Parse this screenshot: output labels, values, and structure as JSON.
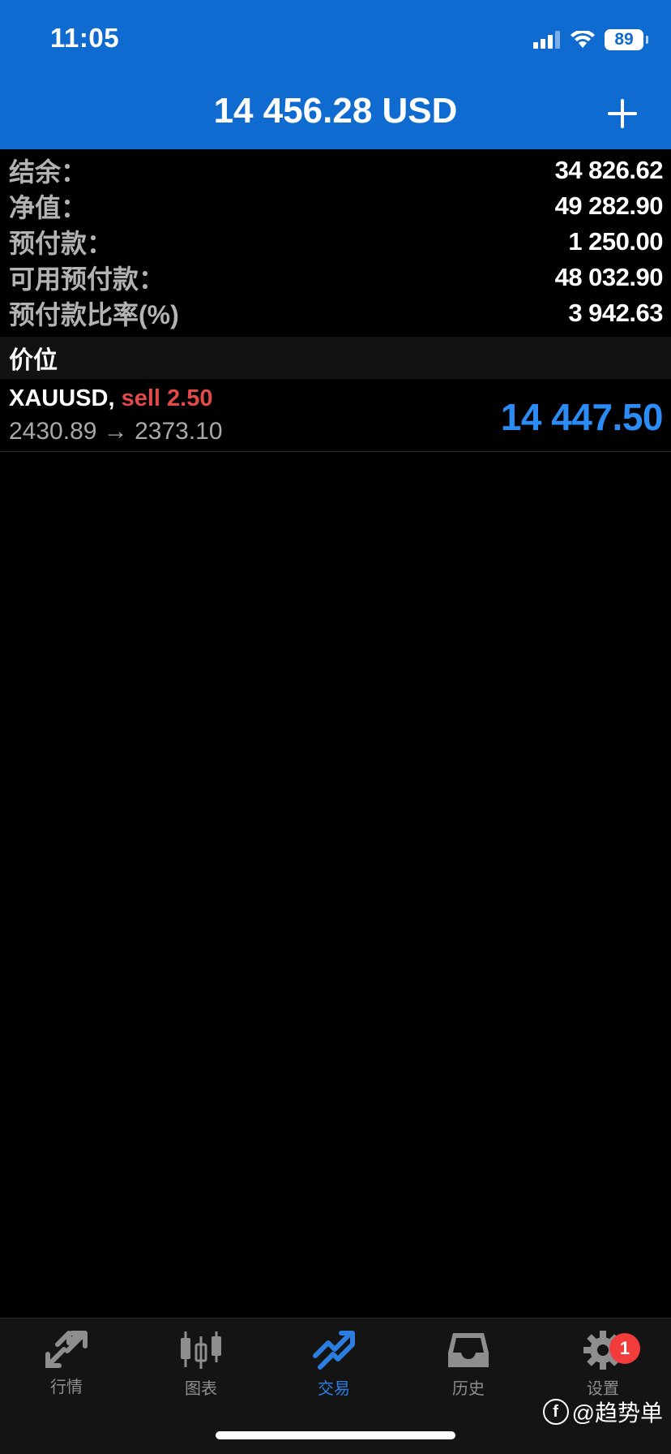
{
  "status_bar": {
    "time": "11:05",
    "battery": "89"
  },
  "header": {
    "title": "14 456.28 USD"
  },
  "summary": [
    {
      "label": "结余：",
      "value": "34 826.62"
    },
    {
      "label": "净值：",
      "value": "49 282.90"
    },
    {
      "label": "预付款：",
      "value": "1 250.00"
    },
    {
      "label": "可用预付款：",
      "value": "48 032.90"
    },
    {
      "label": "预付款比率(%)",
      "value": "3 942.63"
    }
  ],
  "section": {
    "title": "价位"
  },
  "position": {
    "symbol": "XAUUSD,",
    "side": "sell 2.50",
    "prices": "2430.89 → 2373.10",
    "profit": "14 447.50"
  },
  "tabs": [
    {
      "label": "行情",
      "icon": "quotes-icon"
    },
    {
      "label": "图表",
      "icon": "candlestick-chart-icon"
    },
    {
      "label": "交易",
      "icon": "trade-icon",
      "active": true
    },
    {
      "label": "历史",
      "icon": "history-inbox-icon"
    },
    {
      "label": "设置",
      "icon": "gear-icon",
      "badge": "1"
    }
  ],
  "watermark": {
    "text": "@趋势单"
  },
  "colors": {
    "header_bg": "#0f6bd0",
    "profit": "#2b8cf5",
    "sell": "#e24a4a",
    "active_tab": "#2b7de0",
    "badge": "#f23b3b"
  }
}
